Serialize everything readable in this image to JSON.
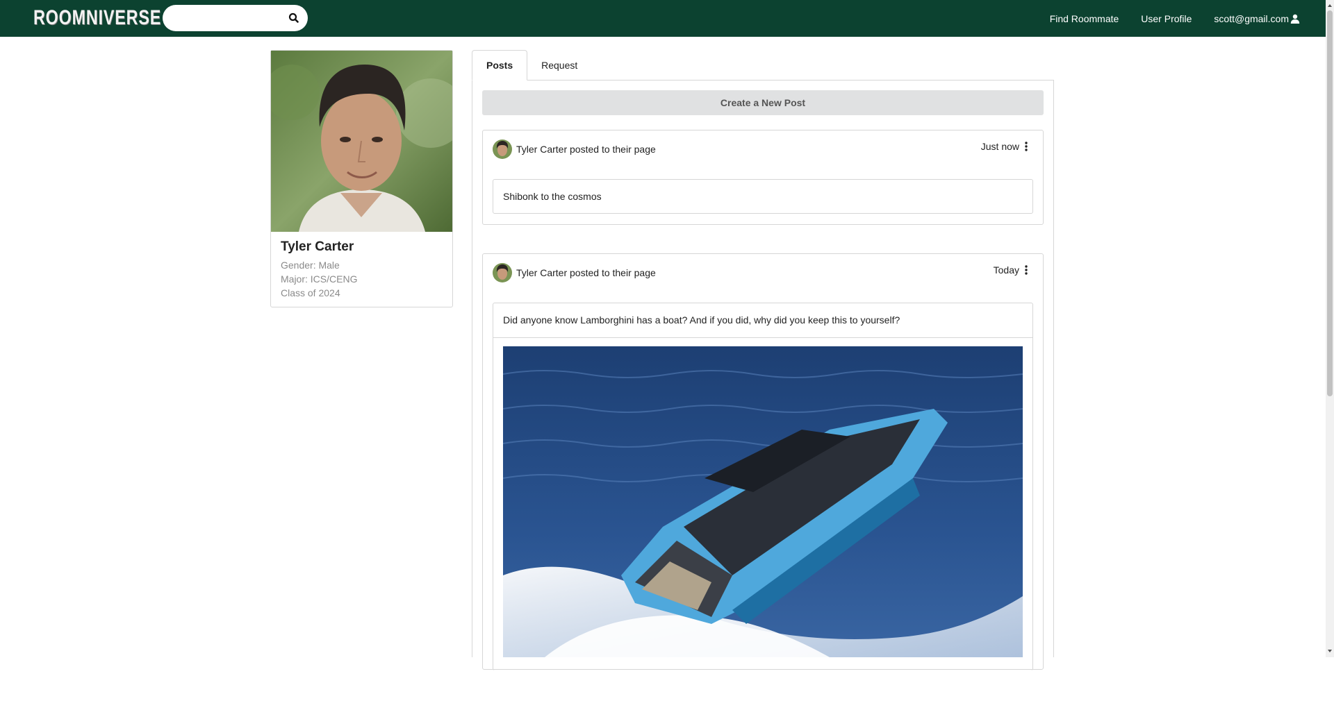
{
  "navbar": {
    "logo_text": "ROOMNIVERSE",
    "search_placeholder": "",
    "links": {
      "find_roommate": "Find Roommate",
      "user_profile": "User Profile",
      "account_email": "scott@gmail.com"
    }
  },
  "profile": {
    "name": "Tyler Carter",
    "gender": "Gender: Male",
    "major": "Major: ICS/CENG",
    "class_year": "Class of 2024"
  },
  "tabs": {
    "posts": "Posts",
    "request": "Request"
  },
  "create_post_label": "Create a New Post",
  "posts": [
    {
      "author_line": "Tyler Carter posted to their page",
      "time": "Just now",
      "text": "Shibonk to the cosmos"
    },
    {
      "author_line": "Tyler Carter posted to their page",
      "time": "Today",
      "text": "Did anyone know Lamborghini has a boat? And if you did, why did you keep this to yourself?"
    }
  ],
  "colors": {
    "navbar_bg": "#0c4230",
    "button_bg": "#e0e1e2",
    "border": "#d6d6d6",
    "muted_text": "#8a8a8a"
  }
}
